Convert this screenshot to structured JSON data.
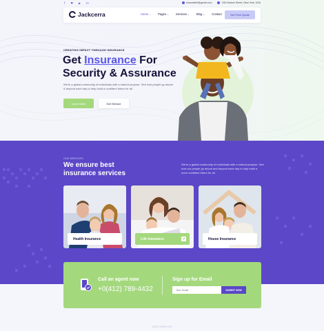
{
  "topbar": {
    "social": [
      "f",
      "♥",
      "▶",
      "in"
    ],
    "email": "smsuddin0@gmail.com",
    "address": "135 Hudson Street, New York, USA"
  },
  "header": {
    "logo": "Jackcerra",
    "nav": [
      {
        "label": "Home",
        "active": true,
        "dropdown": true
      },
      {
        "label": "Pages",
        "active": false,
        "dropdown": true
      },
      {
        "label": "Services",
        "active": false,
        "dropdown": true
      },
      {
        "label": "Blog",
        "active": false,
        "dropdown": true
      },
      {
        "label": "Contact",
        "active": false,
        "dropdown": false
      }
    ],
    "cta": "Get Free Quote"
  },
  "hero": {
    "eyebrow": "CREATING IMPACT THROUGH INSURANCE",
    "title_pre": "Get ",
    "title_highlight": "Insurance",
    "title_mid": " For",
    "title_line2": "Security & Assurance",
    "description": "We're a global community of individuals with a shared purpose. See how people go above & beyond each day to help build a confident future for all.",
    "btn_primary": "Learn More",
    "btn_secondary": "Get Service"
  },
  "services": {
    "eyebrow": "OUR SERVICES",
    "title": "We ensure best insurance services",
    "description": "We're a global community of individuals with a shared purpose. See how our people go above and beyond each day to help build a more confident future for all.",
    "cards": [
      {
        "label": "Health Insurance",
        "highlight": false
      },
      {
        "label": "Life Insurance",
        "highlight": true
      },
      {
        "label": "House Insurance",
        "highlight": false
      }
    ]
  },
  "cta": {
    "agent_label": "Call an agent now",
    "agent_phone": "+0(412) 789-4432",
    "email_label": "Sign up for Email",
    "email_placeholder": "Your Email",
    "submit": "SUBMIT NOW"
  },
  "footer_eyebrow": "OUR SERVICE",
  "colors": {
    "primary": "#5a56e8",
    "band": "#5b47c8",
    "green": "#a4d87d",
    "dark": "#15123a"
  }
}
